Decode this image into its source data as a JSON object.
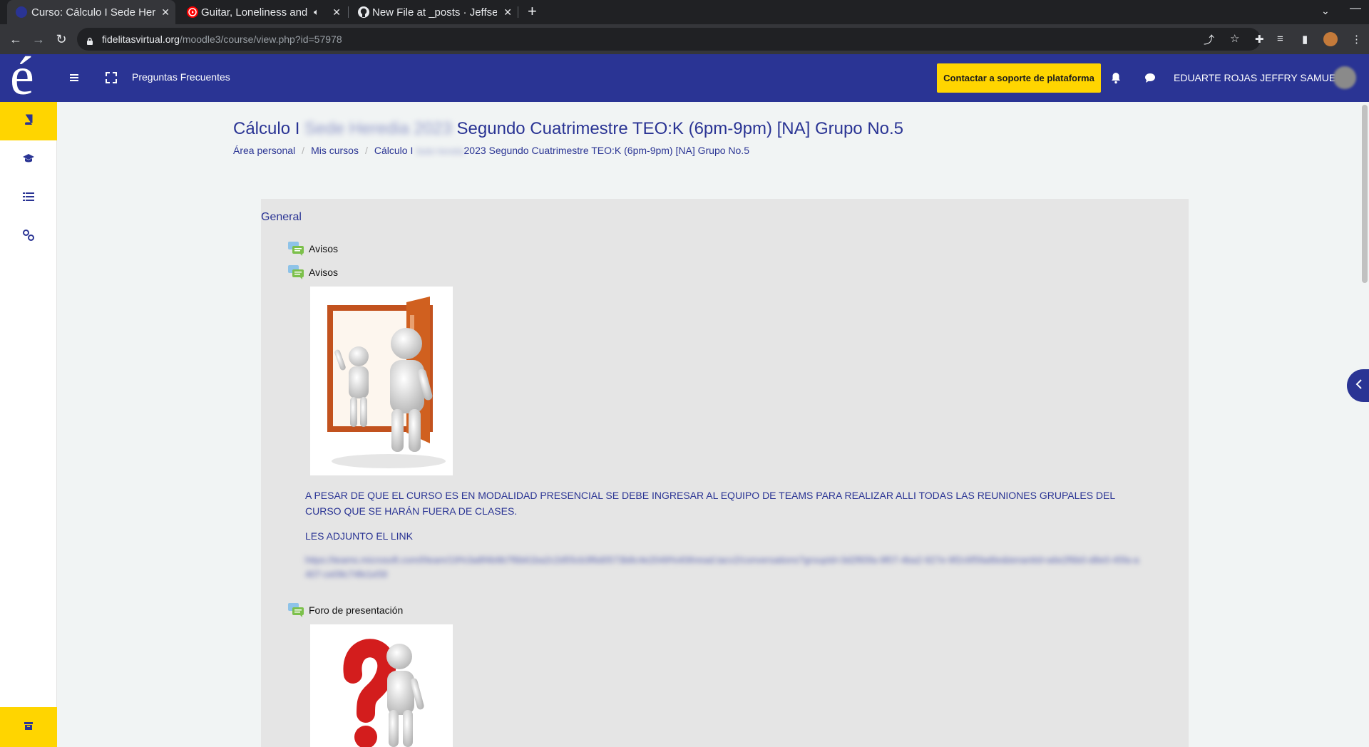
{
  "browser": {
    "tabs": [
      {
        "title": "Curso: Cálculo I Sede Here",
        "active": true
      },
      {
        "title": "Guitar, Loneliness and",
        "active": false,
        "audio": true
      },
      {
        "title": "New File at _posts · Jeffse",
        "active": false
      }
    ],
    "new_tab_symbol": "+",
    "url_host": "fidelitasvirtual.org",
    "url_path": "/moodle3/course/view.php?id=57978"
  },
  "navbar": {
    "logo": "é",
    "faq_label": "Preguntas Frecuentes",
    "support_button_label": "Contactar a soporte de plataforma",
    "username": "EDUARTE ROJAS JEFFRY SAMUEL",
    "colors": {
      "primary": "#2a3494",
      "accent": "#ffd500"
    }
  },
  "header": {
    "title_start": "Cálculo I",
    "title_blurred": "Sede Heredia 2023",
    "title_end": "Segundo Cuatrimestre TEO:K (6pm-9pm) [NA] Grupo No.5",
    "breadcrumb": {
      "home": "Área personal",
      "my_courses": "Mis cursos",
      "course_start": "Cálculo I",
      "course_blurred": "Sede Heredia",
      "course_end": "2023 Segundo Cuatrimestre TEO:K (6pm-9pm) [NA] Grupo No.5"
    }
  },
  "section": {
    "title": "General",
    "activities": [
      {
        "label": "Avisos",
        "icon": "forum-icon"
      },
      {
        "label": "Avisos",
        "icon": "forum-icon"
      },
      {
        "label": "Foro de presentación",
        "icon": "forum-icon"
      }
    ],
    "notice_text": "A PESAR DE  QUE EL CURSO ES EN MODALIDAD PRESENCIAL SE DEBE INGRESAR AL EQUIPO DE TEAMS PARA REALIZAR ALLI TODAS LAS REUNIONES GRUPALES DEL CURSO QUE SE HARÁN FUERA DE CLASES.",
    "link_label": "LES ADJUNTO EL LINK",
    "teams_link": "https://teams.microsoft.com/l/team/19%3a8f4b9b7f6b61ba2c2d55cb3f6d0573b8c4e2049%40thread.tacv2/conversations?groupId=3d2f65fa-9f07-4ba2-927e-9f2c6f5fad6e&tenantId=a6e2f6b0-d8e0-45fa-a407-ce09c74fe1e59"
  }
}
